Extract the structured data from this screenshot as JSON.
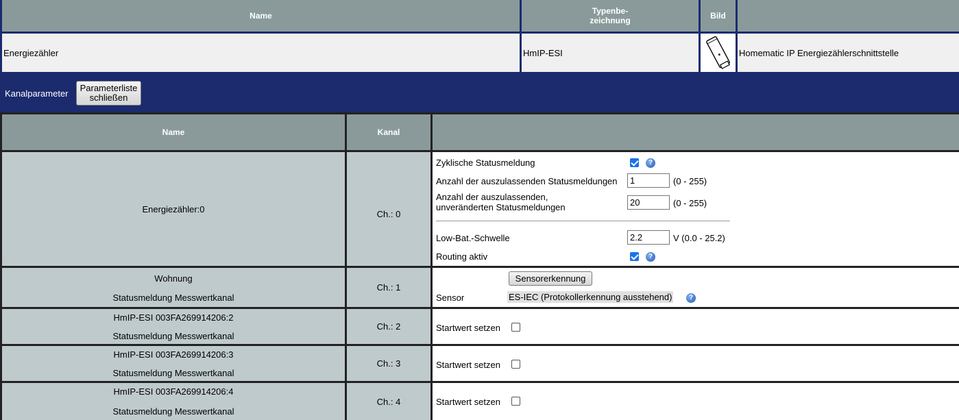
{
  "device_header": {
    "name_col": "Name",
    "type_col": "Typenbe-\nzeichnung",
    "image_col": "Bild",
    "desc_col": ""
  },
  "device": {
    "name": "Energiezähler",
    "type": "HmIP-ESI",
    "image_icon": "device-icon",
    "description": "Homematic IP Energiezählerschnittstelle"
  },
  "toolbar": {
    "label": "Kanalparameter",
    "close_button": "Parameterliste\nschließen"
  },
  "channel_header": {
    "name_col": "Name",
    "channel_col": "Kanal",
    "params_col": ""
  },
  "channels": [
    {
      "name": "Energiezähler:0",
      "channel": "Ch.: 0",
      "params": {
        "cyclic_label": "Zyklische Statusmeldung",
        "cyclic_checked": true,
        "skip_label": "Anzahl der auszulassenden Statusmeldungen",
        "skip_value": "1",
        "skip_range": "(0 - 255)",
        "skip_unchanged_label_1": "Anzahl der auszulassenden,",
        "skip_unchanged_label_2": "unveränderten Statusmeldungen",
        "skip_unchanged_value": "20",
        "skip_unchanged_range": "(0 - 255)",
        "lowbat_label": "Low-Bat.-Schwelle",
        "lowbat_value": "2.2",
        "lowbat_range": "V (0.0 - 25.2)",
        "routing_label": "Routing aktiv",
        "routing_checked": true
      }
    },
    {
      "name": "Wohnung",
      "subname": "Statusmeldung Messwertkanal",
      "channel": "Ch.: 1",
      "params": {
        "detect_button": "Sensorerkennung",
        "sensor_label": "Sensor",
        "sensor_value": "ES-IEC (Protokollerkennung ausstehend)"
      }
    },
    {
      "name": "HmIP-ESI 003FA269914206:2",
      "subname": "Statusmeldung Messwertkanal",
      "channel": "Ch.: 2",
      "params": {
        "start_label": "Startwert setzen",
        "start_checked": false
      }
    },
    {
      "name": "HmIP-ESI 003FA269914206:3",
      "subname": "Statusmeldung Messwertkanal",
      "channel": "Ch.: 3",
      "params": {
        "start_label": "Startwert setzen",
        "start_checked": false
      }
    },
    {
      "name": "HmIP-ESI 003FA269914206:4",
      "subname": "Statusmeldung Messwertkanal",
      "channel": "Ch.: 4",
      "params": {
        "start_label": "Startwert setzen",
        "start_checked": false
      }
    }
  ],
  "colors": {
    "header_bg": "#8a9a9b",
    "page_bg": "#1b2b6e",
    "channel_cell_bg": "#bfcacd",
    "checkbox_accent": "#1a73e8"
  }
}
